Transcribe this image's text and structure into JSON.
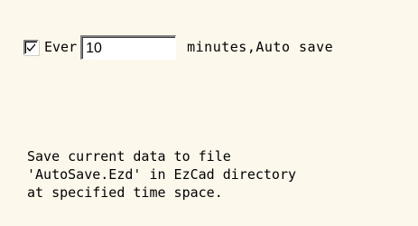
{
  "autosave": {
    "enabled": true,
    "prefix_label": "Ever",
    "interval_value": "10",
    "suffix_label": "minutes,Auto save"
  },
  "description": {
    "line1": "Save current data to file",
    "line2": "'AutoSave.Ezd' in EzCad directory",
    "line3": "at specified time space."
  },
  "icons": {
    "checkbox": "checkmark-icon"
  },
  "colors": {
    "background": "#fcf8ec",
    "field_background": "#ffffff"
  }
}
